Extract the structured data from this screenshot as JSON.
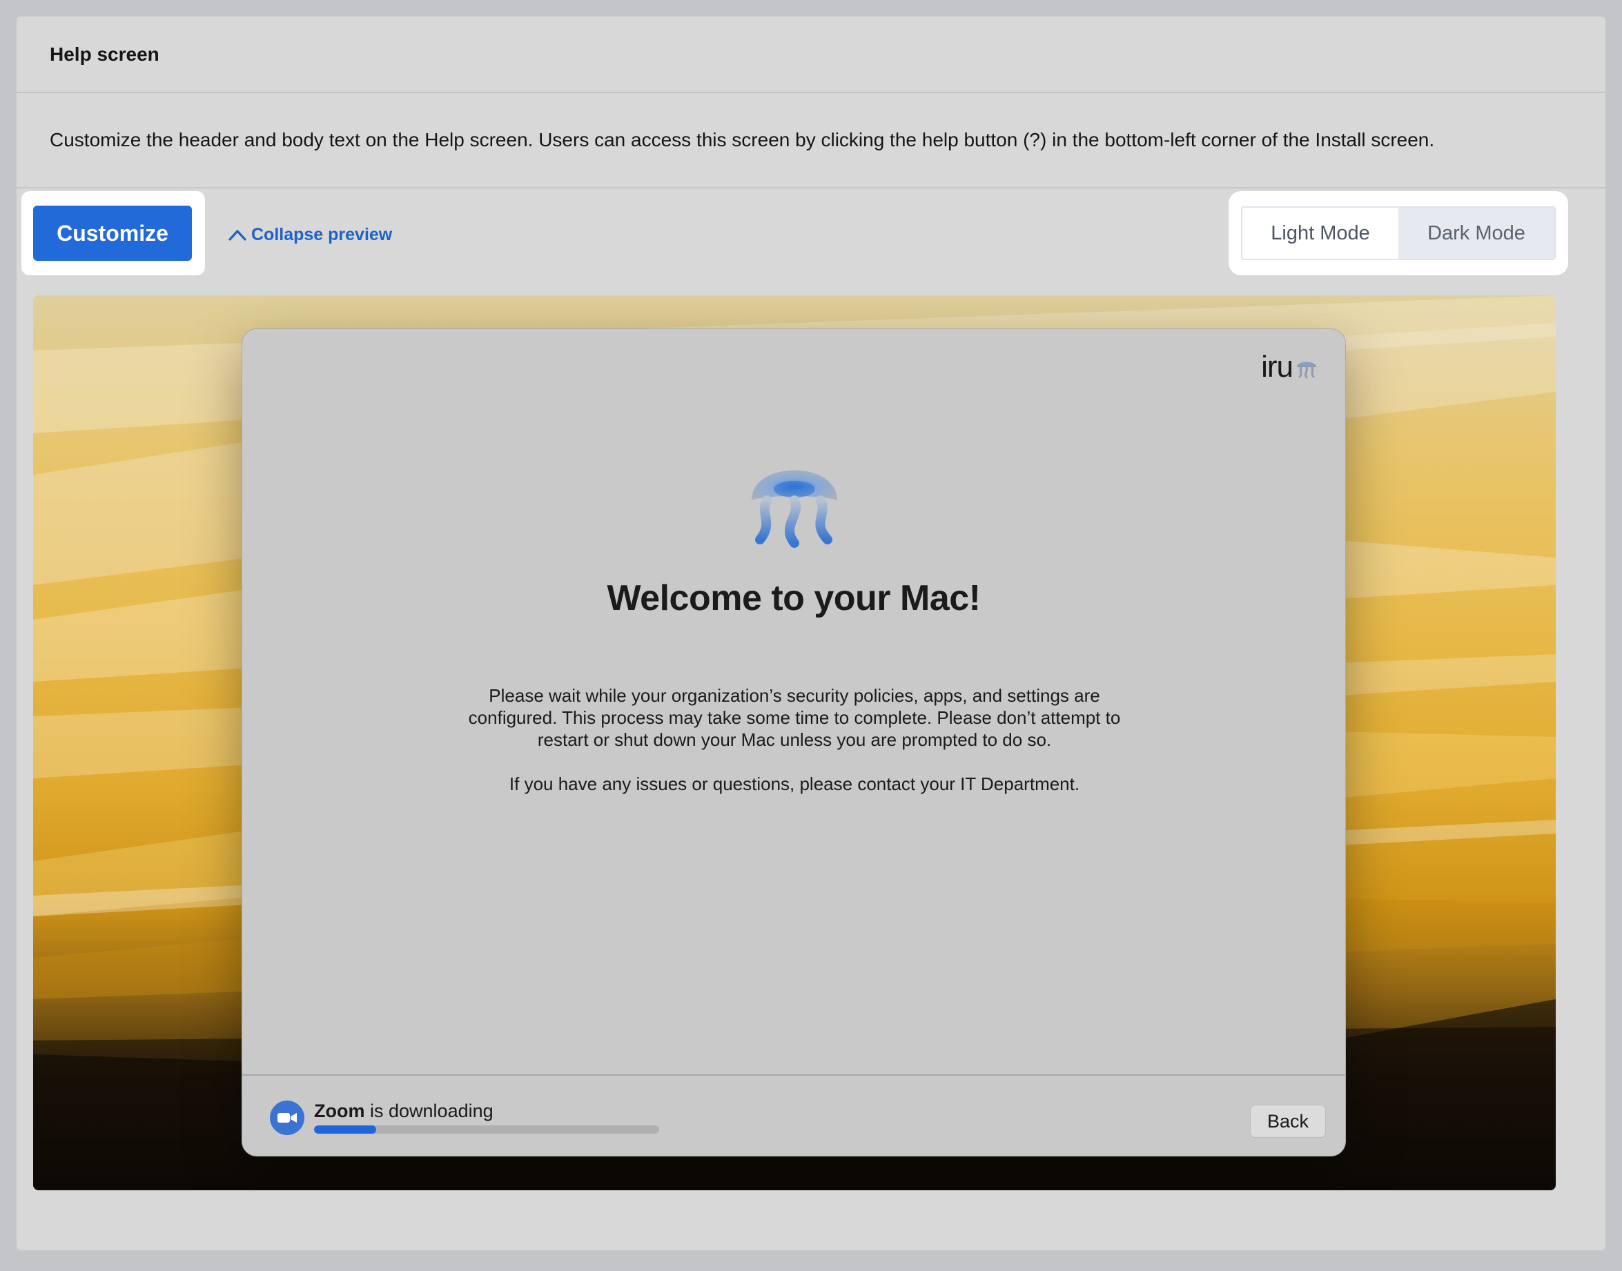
{
  "header": {
    "title": "Help screen"
  },
  "description": "Customize the header and body text on the Help screen. Users can access this screen by clicking the help button (?) in the bottom-left corner of the Install screen.",
  "toolbar": {
    "customize_label": "Customize",
    "collapse_label": "Collapse preview"
  },
  "mode_toggle": {
    "light_label": "Light Mode",
    "dark_label": "Dark Mode",
    "selected": "Light Mode"
  },
  "dialog": {
    "brand": "iru",
    "title": "Welcome to your Mac!",
    "paragraphs": [
      "Please wait while your organization’s security policies, apps, and settings are configured. This process may take some time to complete. Please don’t attempt to restart or shut down your Mac unless you are prompted to do so.",
      "If you have any issues or questions, please contact your IT Department."
    ],
    "footer": {
      "app_name": "Zoom",
      "status_suffix": " is downloading",
      "progress": 0.18,
      "back_label": "Back"
    }
  },
  "colors": {
    "accent": "#2269d9",
    "link": "#1d62c9",
    "progress": "#1f66dc"
  }
}
